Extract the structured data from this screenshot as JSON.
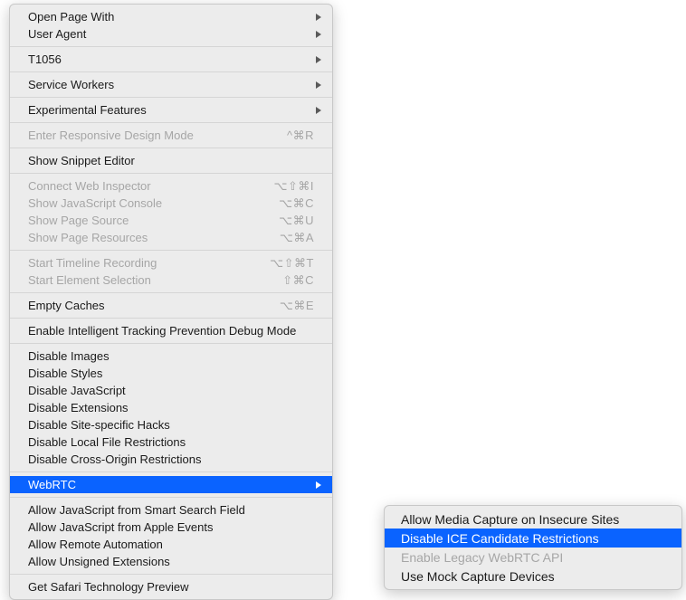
{
  "mainMenu": {
    "groups": [
      [
        {
          "label": "Open Page With",
          "arrow": true,
          "disabled": false
        },
        {
          "label": "User Agent",
          "arrow": true,
          "disabled": false
        }
      ],
      [
        {
          "label": "T1056",
          "arrow": true,
          "disabled": false
        }
      ],
      [
        {
          "label": "Service Workers",
          "arrow": true,
          "disabled": false
        }
      ],
      [
        {
          "label": "Experimental Features",
          "arrow": true,
          "disabled": false
        }
      ],
      [
        {
          "label": "Enter Responsive Design Mode",
          "shortcut": "^⌘R",
          "disabled": true
        }
      ],
      [
        {
          "label": "Show Snippet Editor",
          "disabled": false
        }
      ],
      [
        {
          "label": "Connect Web Inspector",
          "shortcut": "⌥⇧⌘I",
          "disabled": true
        },
        {
          "label": "Show JavaScript Console",
          "shortcut": "⌥⌘C",
          "disabled": true
        },
        {
          "label": "Show Page Source",
          "shortcut": "⌥⌘U",
          "disabled": true
        },
        {
          "label": "Show Page Resources",
          "shortcut": "⌥⌘A",
          "disabled": true
        }
      ],
      [
        {
          "label": "Start Timeline Recording",
          "shortcut": "⌥⇧⌘T",
          "disabled": true
        },
        {
          "label": "Start Element Selection",
          "shortcut": "⇧⌘C",
          "disabled": true
        }
      ],
      [
        {
          "label": "Empty Caches",
          "shortcut": "⌥⌘E",
          "disabled": false
        }
      ],
      [
        {
          "label": "Enable Intelligent Tracking Prevention Debug Mode",
          "disabled": false
        }
      ],
      [
        {
          "label": "Disable Images",
          "disabled": false
        },
        {
          "label": "Disable Styles",
          "disabled": false
        },
        {
          "label": "Disable JavaScript",
          "disabled": false
        },
        {
          "label": "Disable Extensions",
          "disabled": false
        },
        {
          "label": "Disable Site-specific Hacks",
          "disabled": false
        },
        {
          "label": "Disable Local File Restrictions",
          "disabled": false
        },
        {
          "label": "Disable Cross-Origin Restrictions",
          "disabled": false
        }
      ],
      [
        {
          "label": "WebRTC",
          "arrow": true,
          "disabled": false,
          "highlighted": true
        }
      ],
      [
        {
          "label": "Allow JavaScript from Smart Search Field",
          "disabled": false
        },
        {
          "label": "Allow JavaScript from Apple Events",
          "disabled": false
        },
        {
          "label": "Allow Remote Automation",
          "disabled": false
        },
        {
          "label": "Allow Unsigned Extensions",
          "disabled": false
        }
      ],
      [
        {
          "label": "Get Safari Technology Preview",
          "disabled": false
        }
      ]
    ]
  },
  "subMenu": {
    "items": [
      {
        "label": "Allow Media Capture on Insecure Sites",
        "disabled": false
      },
      {
        "label": "Disable ICE Candidate Restrictions",
        "disabled": false,
        "highlighted": true
      },
      {
        "label": "Enable Legacy WebRTC API",
        "disabled": true
      },
      {
        "label": "Use Mock Capture Devices",
        "disabled": false
      }
    ]
  }
}
